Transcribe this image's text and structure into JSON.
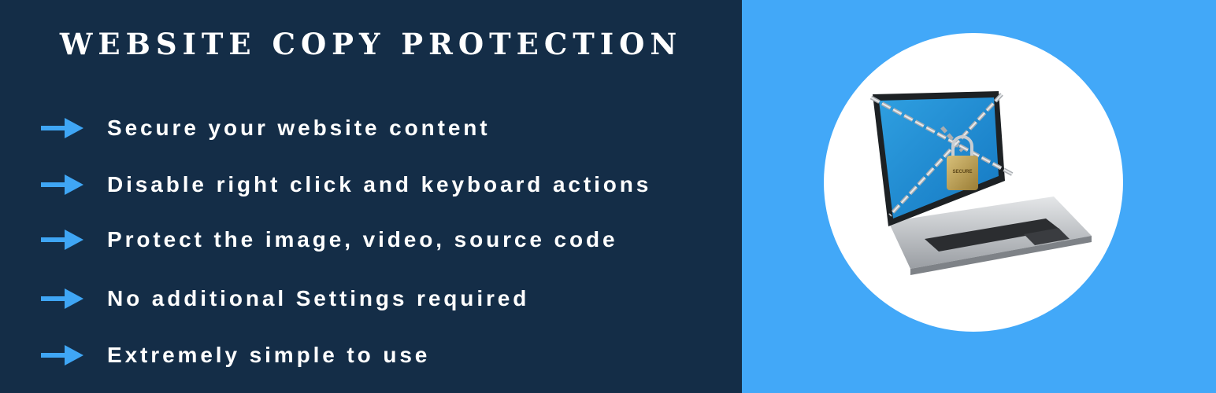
{
  "banner": {
    "title": "WEBSITE COPY PROTECTION",
    "features": [
      "Secure your website content",
      "Disable right click and keyboard actions",
      "Protect the image, video, source code",
      "No additional Settings required",
      "Extremely simple to use"
    ],
    "lock_text": "SECURE",
    "colors": {
      "left_background": "#142d47",
      "right_background": "#42a8f8",
      "arrow": "#3fa6f5",
      "text": "#ffffff",
      "circle": "#ffffff"
    },
    "icons": {
      "bullet": "arrow-right-icon",
      "illustration": "locked-laptop-icon"
    }
  }
}
